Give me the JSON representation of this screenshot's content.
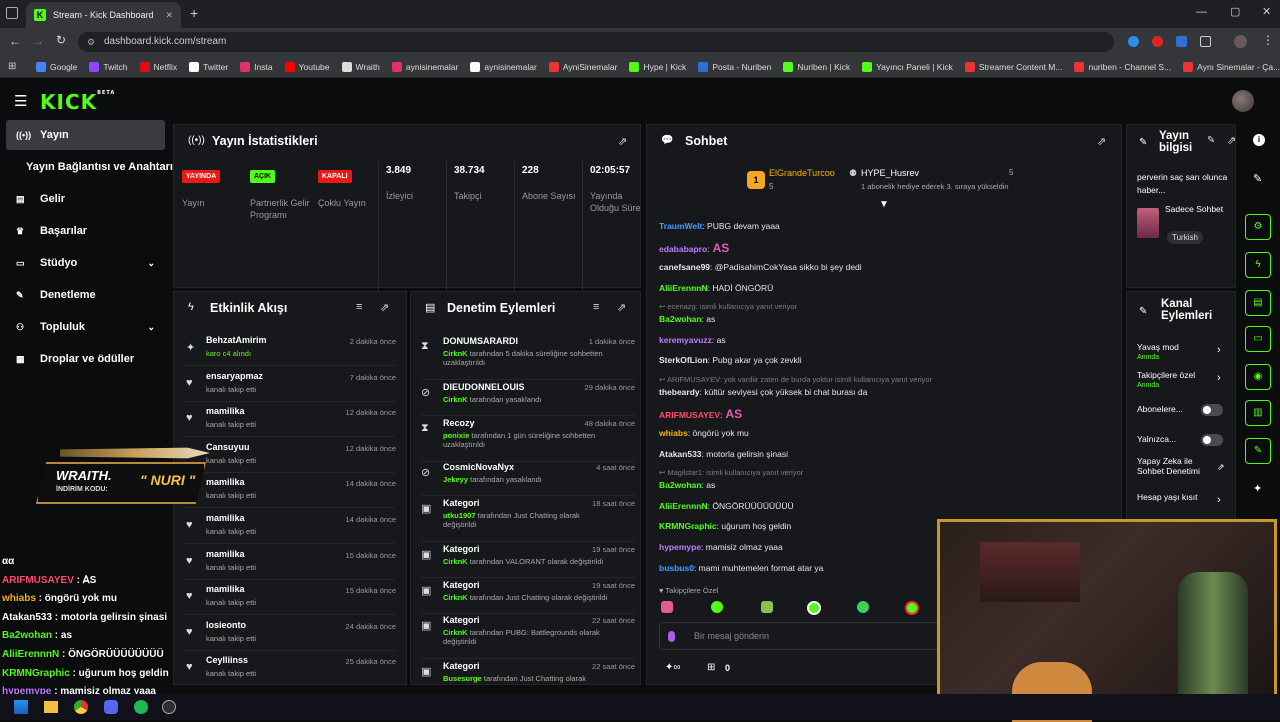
{
  "browser": {
    "tab_title": "Stream - Kick Dashboard",
    "url": "dashboard.kick.com/stream",
    "bookmarks": [
      "Google",
      "Twitch",
      "Netflix",
      "Twitter",
      "Insta",
      "Youtube",
      "Wraith",
      "aynisinemalar",
      "aynisinemalar",
      "AyniSinemalar",
      "Hype | Kick",
      "Posta - Nuriben",
      "Nuriben | Kick",
      "Yayıncı Paneli | Kick",
      "Streamer Content M...",
      "nuriben - Channel S...",
      "Aynı Sinemalar - Ça..."
    ]
  },
  "kick": {
    "logo": "KICK",
    "logo_tag": "BETA"
  },
  "sidebar": {
    "items": [
      {
        "label": "Yayın",
        "icon": "broadcast-icon"
      },
      {
        "label": "Yayın Bağlantısı ve Anahtarı",
        "icon": ""
      },
      {
        "label": "Gelir",
        "icon": "money-icon"
      },
      {
        "label": "Başarılar",
        "icon": "trophy-icon"
      },
      {
        "label": "Stüdyo",
        "icon": "studio-icon"
      },
      {
        "label": "Denetleme",
        "icon": "wrench-icon"
      },
      {
        "label": "Topluluk",
        "icon": "people-icon"
      },
      {
        "label": "Droplar ve ödüller",
        "icon": "gift-icon"
      }
    ]
  },
  "stats": {
    "title": "Yayın İstatistikleri",
    "badges": [
      {
        "text": "YAYINDA",
        "label": "Yayın",
        "color": "#e91916"
      },
      {
        "text": "AÇIK",
        "label": "Partnerlik Gelir Programı",
        "color": "#53fc18"
      },
      {
        "text": "KAPALI",
        "label": "Çoklu Yayın",
        "color": "#e91916"
      }
    ],
    "numbers": [
      {
        "value": "3.849",
        "label": "İzleyici"
      },
      {
        "value": "38.734",
        "label": "Takipçi"
      },
      {
        "value": "228",
        "label": "Abone Sayısı"
      },
      {
        "value": "02:05:57",
        "label": "Yayında Olduğu Süre"
      }
    ]
  },
  "activity": {
    "title": "Etkinlik Akışı",
    "rows": [
      {
        "name": "BehzatAmirim",
        "sub": "karo c4 alındı",
        "sub_user": "karo c4",
        "time": "2 dakika önce",
        "icon": "sparkle-icon"
      },
      {
        "name": "ensaryapmaz",
        "sub": "kanalı takip etti",
        "time": "7 dakika önce",
        "icon": "heart-icon"
      },
      {
        "name": "mamilika",
        "sub": "kanalı takip etti",
        "time": "12 dakika önce",
        "icon": "heart-icon"
      },
      {
        "name": "Cansuyuu",
        "sub": "kanalı takip etti",
        "time": "12 dakika önce",
        "icon": "heart-icon"
      },
      {
        "name": "mamilika",
        "sub": "kanalı takip etti",
        "time": "14 dakika önce",
        "icon": "heart-icon"
      },
      {
        "name": "mamilika",
        "sub": "kanalı takip etti",
        "time": "14 dakika önce",
        "icon": "heart-icon"
      },
      {
        "name": "mamilika",
        "sub": "kanalı takip etti",
        "time": "15 dakika önce",
        "icon": "heart-icon"
      },
      {
        "name": "mamilika",
        "sub": "kanalı takip etti",
        "time": "15 dakika önce",
        "icon": "heart-icon"
      },
      {
        "name": "losieonto",
        "sub": "kanalı takip etti",
        "time": "24 dakika önce",
        "icon": "heart-icon"
      },
      {
        "name": "Ceylliinss",
        "sub": "kanalı takip etti",
        "time": "25 dakika önce",
        "icon": "heart-icon"
      }
    ]
  },
  "moderation": {
    "title": "Denetim Eylemleri",
    "rows": [
      {
        "name": "DONUMSARARDI",
        "user": "CirknK",
        "sub": "tarafından 5 dakika süreliğine sohbetten uzaklaştırıldı",
        "time": "1 dakika önce",
        "icon": "hourglass-icon"
      },
      {
        "name": "DIEUDONNELOUIS",
        "user": "CirknK",
        "sub": "tarafından yasaklandı",
        "time": "29 dakika önce",
        "icon": "ban-icon"
      },
      {
        "name": "Recozy",
        "user": "ponixie",
        "sub": "tarafından 1 gün süreliğine sohbetten uzaklaştırıldı",
        "time": "48 dakika önce",
        "icon": "hourglass-icon"
      },
      {
        "name": "CosmicNovaNyx",
        "user": "Jekeyy",
        "sub": "tarafından yasaklandı",
        "time": "4 saat önce",
        "icon": "ban-icon"
      },
      {
        "name": "Kategori",
        "user": "utku1907",
        "sub": "tarafından Just Chatting olarak değiştirildi",
        "time": "18 saat önce",
        "icon": "category-icon"
      },
      {
        "name": "Kategori",
        "user": "CirknK",
        "sub": "tarafından VALORANT olarak değiştirildi",
        "time": "19 saat önce",
        "icon": "category-icon"
      },
      {
        "name": "Kategori",
        "user": "CirknK",
        "sub": "tarafından Just Chatting olarak değiştirildi",
        "time": "19 saat önce",
        "icon": "category-icon"
      },
      {
        "name": "Kategori",
        "user": "CirknK",
        "sub": "tarafından PUBG: Battlegrounds olarak değiştirildi",
        "time": "22 saat önce",
        "icon": "category-icon"
      },
      {
        "name": "Kategori",
        "user": "Busesurge",
        "sub": "tarafından Just Chatting olarak",
        "time": "22 saat önce",
        "icon": "category-icon"
      }
    ]
  },
  "chat": {
    "title": "Sohbet",
    "pinned": {
      "user1": "ElGrandeTurcoo",
      "count1": "5",
      "user2": "HYPE_Husrev",
      "count2": "5",
      "text": "1 abonelik hediye ederek 3. sıraya yükseldin"
    },
    "messages": [
      {
        "user": "TraumWelt",
        "text": ": PUBG devam yaaa",
        "color": "#3aa0ff"
      },
      {
        "user": "edababapro",
        "text": ":",
        "color": "#c07cff",
        "emote": "AS"
      },
      {
        "user": "canefsane99",
        "text": ": @PadisahimCokYasa sikko bi şey dedi",
        "color": "#e6e6e6"
      },
      {
        "user": "AliiErennnN",
        "text": ": HADİ ÖNGÖRÜ",
        "color": "#53fc18"
      },
      {
        "reply": "ecenazg: isimli kullanıcıya yanıt veriyor"
      },
      {
        "user": "Ba2wohan",
        "text": ": as",
        "color": "#53fc18"
      },
      {
        "user": "keremyavuzz",
        "text": ": as",
        "color": "#c07cff"
      },
      {
        "user": "SterkOfLion",
        "text": ": Pubg akar ya çok zevkli",
        "color": "#e6e6e6"
      },
      {
        "reply": "ARIFMUSAYEV: yok vardiir zaten de burda yoktur isimli kullanıcıya yanıt veriyor"
      },
      {
        "user": "thebeardy",
        "text": ": kültür seviyesi çok yüksek bi chat burası da",
        "color": "#e6e6e6"
      },
      {
        "user": "ARIFMUSAYEV",
        "text": ":",
        "color": "#ff4d6d",
        "emote": "AS"
      },
      {
        "user": "whiabs",
        "text": ": öngörü yok mu",
        "color": "#f5b400"
      },
      {
        "user": "Atakan533",
        "text": ": motorla gelirsin şinasi",
        "color": "#e6e6e6"
      },
      {
        "reply": "Magilstar1: isimli kullanıcıya yanıt veriyor"
      },
      {
        "user": "Ba2wohan",
        "text": ": as",
        "color": "#53fc18"
      },
      {
        "user": "AliiErennnN",
        "text": ": ÖNGÖRÜÜÜÜÜÜÜÜ",
        "color": "#53fc18"
      },
      {
        "user": "KRMNGraphic",
        "text": ": uğurum hoş geldin",
        "color": "#53fc18"
      },
      {
        "user": "hypemype",
        "text": ": mamisiz olmaz yaaa",
        "color": "#c07cff"
      },
      {
        "user": "busbus0",
        "text": ": mami muhtemelen format atar ya",
        "color": "#3aa0ff"
      }
    ],
    "followers_only": "Takipçilere Özel",
    "input_placeholder": "Bir mesaj gönderin",
    "footer_count": "0"
  },
  "stream_info": {
    "title": "Yayın bilgisi",
    "description": "perverin saç sarı olunca haber...",
    "category": "Sadece Sohbet",
    "language": "Turkish"
  },
  "channel_actions": {
    "title": "Kanal Eylemleri",
    "items": [
      {
        "label": "Yavaş mod",
        "sub": "Anında",
        "control": "chevron"
      },
      {
        "label": "Takipçilere özel",
        "sub": "Anında",
        "control": "chevron"
      },
      {
        "label": "Abonelere...",
        "sub": "",
        "control": "toggle"
      },
      {
        "label": "Yalnızca...",
        "sub": "",
        "control": "toggle"
      },
      {
        "label": "Yapay Zeka ile Sohbet Denetimi",
        "sub": "",
        "control": "external"
      },
      {
        "label": "Hesap yaşı kısıt",
        "sub": "",
        "control": "chevron"
      }
    ]
  },
  "overlay": {
    "promo_brand": "WRAITH.",
    "promo_code_label": "İNDİRİM KODU:",
    "promo_code": "\" NURI \"",
    "chat_lines": [
      {
        "user": "",
        "text": "αα",
        "color": "#ffffff"
      },
      {
        "user": "ARIFMUSAYEV",
        "text": " : ꓮS",
        "color": "#ff4d6d"
      },
      {
        "user": "whiabs",
        "text": " : öngörü yok mu",
        "color": "#f5b400"
      },
      {
        "user": "Atakan533",
        "text": " : motorla gelirsin şinasi",
        "color": "#ffffff"
      },
      {
        "user": "Ba2wohan",
        "text": " : as",
        "color": "#53fc18"
      },
      {
        "user": "AliiErennnN",
        "text": " : ÖNGÖRÜÜÜÜÜÜÜÜ",
        "color": "#53fc18"
      },
      {
        "user": "KRMNGraphic",
        "text": " : uğurum hoş geldin",
        "color": "#53fc18"
      },
      {
        "user": "hypemype",
        "text": " : mamisiz olmaz yaaa",
        "color": "#c07cff"
      }
    ]
  },
  "colors": {
    "accent": "#53fc18",
    "live_red": "#e91916",
    "panel": "#17181b"
  }
}
